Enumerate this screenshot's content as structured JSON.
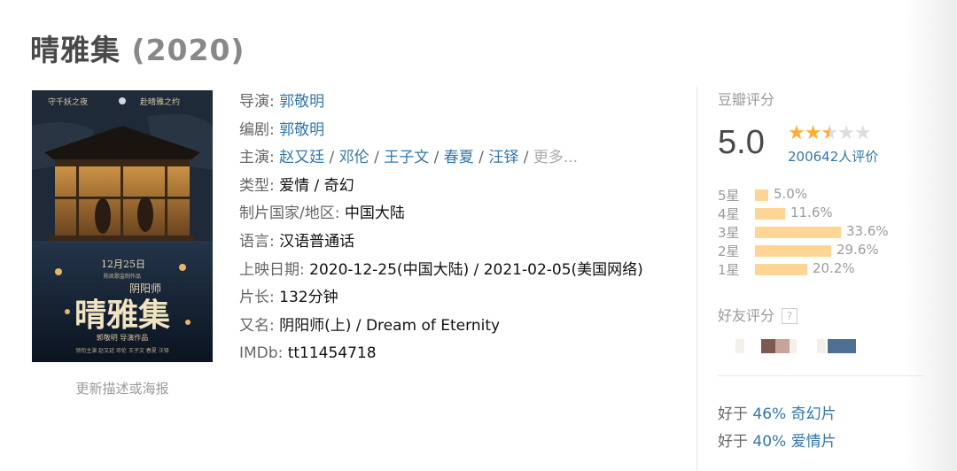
{
  "title": {
    "name": "晴雅集",
    "year": "(2020)"
  },
  "poster": {
    "top_left": "守千妖之夜",
    "top_right": "赴晴雅之约",
    "date": "12月25日",
    "presented": "陈凯歌监制作品",
    "title_small": "阴阳师",
    "title_big": "晴雅集",
    "director_line": "郭敬明 导演作品",
    "cast_line": "领衔主演 赵又廷 邓伦 王子文 春夏 汪铎"
  },
  "update_link": "更新描述或海报",
  "info": {
    "director_label": "导演",
    "director": "郭敬明",
    "writer_label": "编剧",
    "writer": "郭敬明",
    "cast_label": "主演",
    "cast": [
      "赵又廷",
      "邓伦",
      "王子文",
      "春夏",
      "汪铎"
    ],
    "cast_more": "更多...",
    "genre_label": "类型:",
    "genre": "爱情 / 奇幻",
    "country_label": "制片国家/地区:",
    "country": "中国大陆",
    "language_label": "语言:",
    "language": "汉语普通话",
    "release_label": "上映日期:",
    "release": "2020-12-25(中国大陆) / 2021-02-05(美国网络)",
    "runtime_label": "片长:",
    "runtime": "132分钟",
    "aka_label": "又名:",
    "aka": "阴阳师(上) / Dream of Eternity",
    "imdb_label": "IMDb:",
    "imdb": "tt11454718"
  },
  "rating": {
    "label": "豆瓣评分",
    "score": "5.0",
    "stars": 2.5,
    "votes": "200642人评价",
    "bars": [
      {
        "label": "5星",
        "pct": "5.0%",
        "value": 5.0
      },
      {
        "label": "4星",
        "pct": "11.6%",
        "value": 11.6
      },
      {
        "label": "3星",
        "pct": "33.6%",
        "value": 33.6
      },
      {
        "label": "2星",
        "pct": "29.6%",
        "value": 29.6
      },
      {
        "label": "1星",
        "pct": "20.2%",
        "value": 20.2
      }
    ],
    "friends_label": "好友评分",
    "help_icon": "question-icon",
    "better": [
      {
        "prefix": "好于",
        "link": "46% 奇幻片"
      },
      {
        "prefix": "好于",
        "link": "40% 爱情片"
      }
    ]
  },
  "colors": {
    "link": "#3377aa",
    "bar": "#ffd596",
    "star": "#ffad33"
  }
}
